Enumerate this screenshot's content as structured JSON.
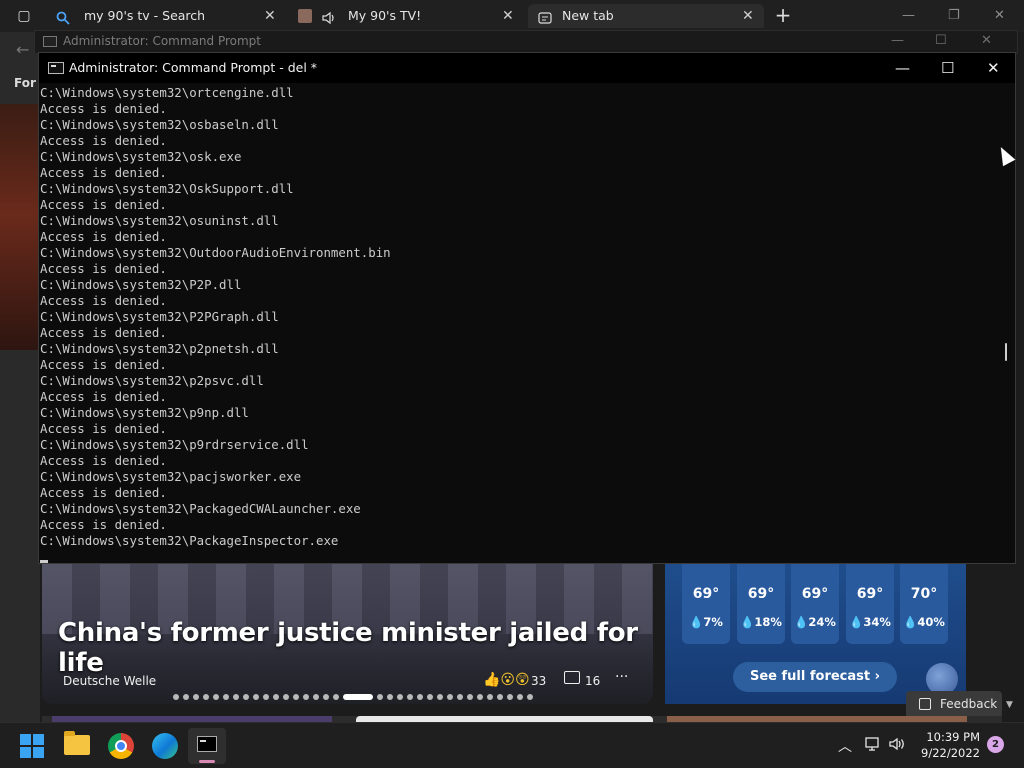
{
  "browser": {
    "tabs": [
      {
        "label": "my 90's tv - Search",
        "close": "✕"
      },
      {
        "label": "My 90's TV!",
        "close": "✕"
      },
      {
        "label": "New tab",
        "close": "✕"
      }
    ],
    "new_tab": "+",
    "side_label": "For",
    "controls": {
      "minimize": "—",
      "maximize": "❐",
      "close": "✕"
    }
  },
  "cmd_background": {
    "title": "Administrator: Command Prompt"
  },
  "cmd": {
    "title": "Administrator: Command Prompt - del  *",
    "controls": {
      "minimize": "—",
      "maximize": "☐",
      "close": "✕"
    },
    "lines": [
      "C:\\Windows\\system32\\ortcengine.dll",
      "Access is denied.",
      "C:\\Windows\\system32\\osbaseln.dll",
      "Access is denied.",
      "C:\\Windows\\system32\\osk.exe",
      "Access is denied.",
      "C:\\Windows\\system32\\OskSupport.dll",
      "Access is denied.",
      "C:\\Windows\\system32\\osuninst.dll",
      "Access is denied.",
      "C:\\Windows\\system32\\OutdoorAudioEnvironment.bin",
      "Access is denied.",
      "C:\\Windows\\system32\\P2P.dll",
      "Access is denied.",
      "C:\\Windows\\system32\\P2PGraph.dll",
      "Access is denied.",
      "C:\\Windows\\system32\\p2pnetsh.dll",
      "Access is denied.",
      "C:\\Windows\\system32\\p2psvc.dll",
      "Access is denied.",
      "C:\\Windows\\system32\\p9np.dll",
      "Access is denied.",
      "C:\\Windows\\system32\\p9rdrservice.dll",
      "Access is denied.",
      "C:\\Windows\\system32\\pacjsworker.exe",
      "Access is denied.",
      "C:\\Windows\\system32\\PackagedCWALauncher.exe",
      "Access is denied.",
      "C:\\Windows\\system32\\PackageInspector.exe"
    ]
  },
  "news": {
    "headline": "China's former justice minister jailed for life",
    "source": "Deutsche Welle",
    "reactions": "33",
    "comments": "16",
    "more": "···",
    "carousel_dots": 34,
    "carousel_current": 17
  },
  "weather": {
    "days": [
      {
        "temp": "69°",
        "rain": "7%"
      },
      {
        "temp": "69°",
        "rain": "18%"
      },
      {
        "temp": "69°",
        "rain": "24%"
      },
      {
        "temp": "69°",
        "rain": "34%"
      },
      {
        "temp": "70°",
        "rain": "40%"
      }
    ],
    "forecast_button": "See full forecast"
  },
  "feedback": "Feedback",
  "taskbar": {
    "time": "10:39 PM",
    "date": "9/22/2022",
    "notifications": "2"
  }
}
